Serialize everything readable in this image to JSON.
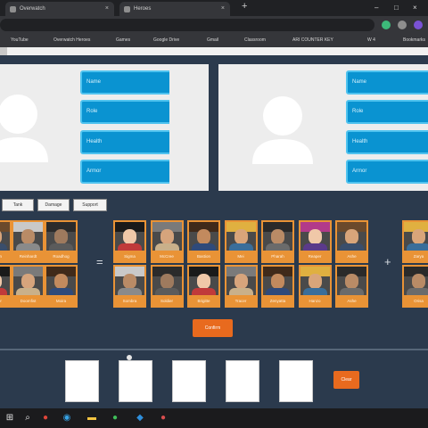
{
  "browser": {
    "tabs": [
      {
        "title": "Overwatch",
        "close": "×"
      },
      {
        "title": "Heroes",
        "close": "×"
      }
    ],
    "new_tab": "+",
    "window_controls": [
      "–",
      "□",
      "×"
    ],
    "bookmarks": [
      {
        "label": "YouTube",
        "color": "#e62117"
      },
      {
        "label": "Overwatch Heroes",
        "color": "#e8532a"
      },
      {
        "label": "Games",
        "color": "#e74c1c"
      },
      {
        "label": "Google Drive",
        "color": "#3b82f6"
      },
      {
        "label": "Gmail",
        "color": "#f2c21b"
      },
      {
        "label": "Classroom",
        "color": "#4caf50"
      },
      {
        "label": "ARI COUNTER KEY",
        "color": "#f2c21b"
      },
      {
        "label": "W 4",
        "color": "#9aa0a6"
      },
      {
        "label": "Bookmarks",
        "color": "#9aa0a6"
      }
    ]
  },
  "profiles": [
    {
      "avatar_icon": "user-placeholder-icon",
      "fields": [
        "Name",
        "Role",
        "Health",
        "Armor"
      ]
    },
    {
      "avatar_icon": "user-placeholder-icon",
      "fields": [
        "Name",
        "Role",
        "Health",
        "Armor"
      ]
    }
  ],
  "filters": [
    "Tank",
    "Damage",
    "Support"
  ],
  "hero_groups": [
    {
      "heroes": [
        "Bastion",
        "Reinhardt",
        "Roadhog",
        "Reaper",
        "Doomfist",
        "Moira"
      ]
    },
    {
      "heroes": [
        "Sigma",
        "McCree",
        "Bastion",
        "Mei",
        "Pharah",
        "Reaper",
        "Ashe",
        "Sombra",
        "Soldier",
        "Brigitte",
        "Tracer",
        "Zenyatta",
        "Hanzo",
        "Ashe"
      ]
    },
    {
      "heroes": [
        "Zarya",
        "Orisa"
      ]
    }
  ],
  "separators": [
    "=",
    "+"
  ],
  "confirm_label": "Confirm",
  "team_slots": 5,
  "clear_label": "Clear",
  "taskbar": [
    "windows-start-icon",
    "search-icon",
    "chrome-icon",
    "edge-icon",
    "file-explorer-icon",
    "wechat-icon",
    "vscode-icon",
    "chrome-dev-icon"
  ]
}
